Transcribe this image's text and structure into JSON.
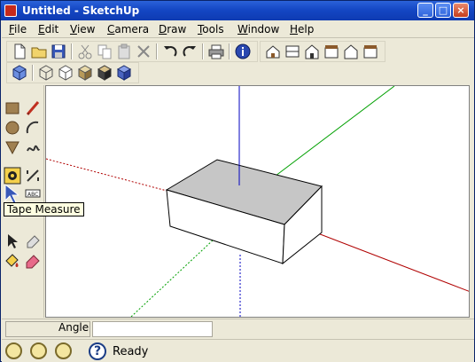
{
  "window": {
    "title": "Untitled - SketchUp"
  },
  "titlebar_buttons": {
    "minimize": "_",
    "maximize": "□",
    "close": "×"
  },
  "menu": {
    "items": [
      {
        "label": "File",
        "accel": "F"
      },
      {
        "label": "Edit",
        "accel": "E"
      },
      {
        "label": "View",
        "accel": "V"
      },
      {
        "label": "Camera",
        "accel": "C"
      },
      {
        "label": "Draw",
        "accel": "D"
      },
      {
        "label": "Tools",
        "accel": "T"
      },
      {
        "label": "Window",
        "accel": "W"
      },
      {
        "label": "Help",
        "accel": "H"
      }
    ]
  },
  "toolbar_standard": [
    "new-icon",
    "open-icon",
    "save-icon",
    "cut-icon",
    "copy-icon",
    "paste-icon",
    "erase-icon",
    "undo-icon",
    "redo-icon",
    "print-icon",
    "model-info-icon"
  ],
  "toolbar_views": [
    "iso-view-icon",
    "top-view-icon",
    "front-view-icon",
    "right-view-icon",
    "back-view-icon",
    "left-view-icon"
  ],
  "toolbar_styles": [
    "xray-icon",
    "wireframe-icon",
    "hidden-line-icon",
    "shaded-icon",
    "shaded-textures-icon",
    "monochrome-icon"
  ],
  "tooltip": {
    "text": "Tape Measure"
  },
  "vcb": {
    "label": "Angle",
    "value": ""
  },
  "status": {
    "text": "Ready"
  },
  "colors": {
    "accent": "#0a246a",
    "axis_red": "#b00000",
    "axis_green": "#00a000",
    "axis_blue": "#0000c0",
    "box_top": "#c6c6c6",
    "box_side": "#ffffff"
  }
}
